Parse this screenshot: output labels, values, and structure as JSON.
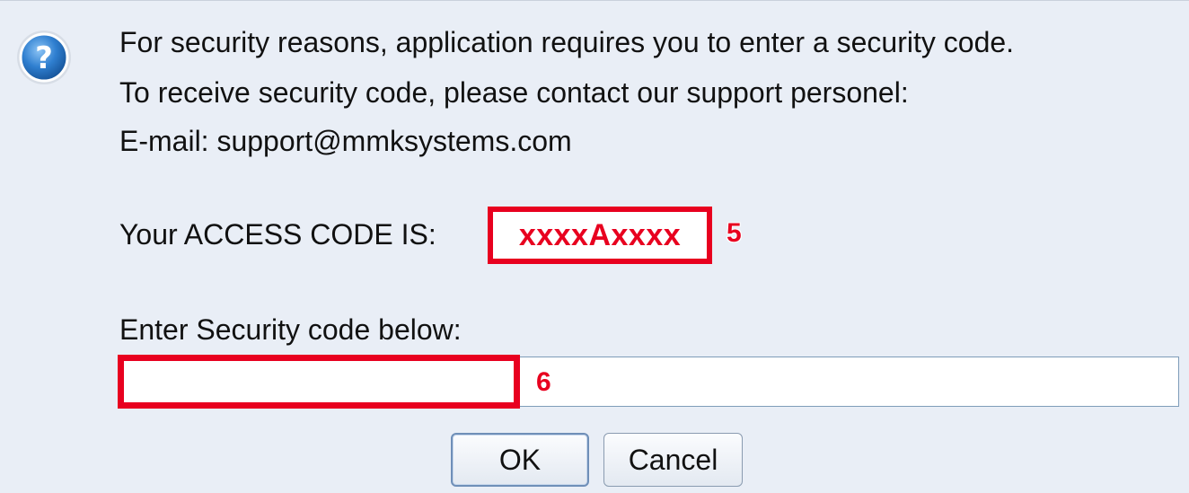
{
  "dialog": {
    "message_line_1": "For security reasons, application requires you to enter a security code.",
    "message_line_2": "To receive security code, please contact our support personel:",
    "message_line_3": "E-mail: support@mmksystems.com",
    "access_code_label": "Your ACCESS CODE IS:",
    "access_code_value": "xxxxAxxxx",
    "security_code_label": "Enter Security code below:",
    "security_code_input_value": "",
    "ok_label": "OK",
    "cancel_label": "Cancel",
    "icon": "question-icon"
  },
  "annotations": {
    "access_code_marker": "5",
    "input_marker": "6"
  },
  "colors": {
    "highlight": "#e8001f",
    "background": "#e9eef6",
    "icon_blue": "#2f7fd0"
  }
}
